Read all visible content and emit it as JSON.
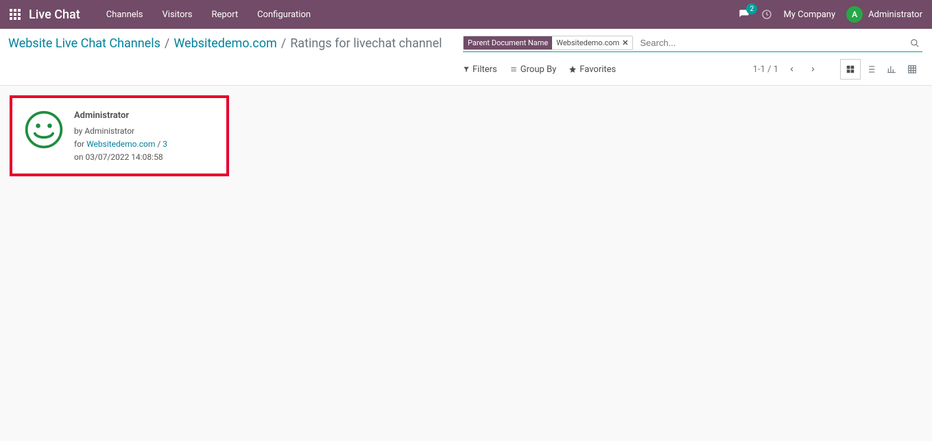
{
  "navbar": {
    "brand": "Live Chat",
    "menu": [
      "Channels",
      "Visitors",
      "Report",
      "Configuration"
    ],
    "messages_count": "2",
    "company": "My Company",
    "user_initial": "A",
    "user_name": "Administrator"
  },
  "breadcrumb": {
    "items": [
      "Website Live Chat Channels",
      "Websitedemo.com"
    ],
    "current": "Ratings for livechat channel",
    "sep": "/"
  },
  "search": {
    "facet_label": "Parent Document Name",
    "facet_value": "Websitedemo.com",
    "placeholder": "Search..."
  },
  "toolbar": {
    "filters": "Filters",
    "group_by": "Group By",
    "favorites": "Favorites"
  },
  "pager": {
    "text": "1-1 / 1"
  },
  "card": {
    "title": "Administrator",
    "by_prefix": "by ",
    "by_name": "Administrator",
    "for_prefix": "for ",
    "for_link": "Websitedemo.com",
    "for_sep": " / ",
    "for_count": "3",
    "on_prefix": "on ",
    "on_date": "03/07/2022 14:08:58"
  },
  "colors": {
    "accent": "#714B67",
    "teal": "#00A09D",
    "link": "#00829B",
    "highlight_border": "#e6002e"
  }
}
